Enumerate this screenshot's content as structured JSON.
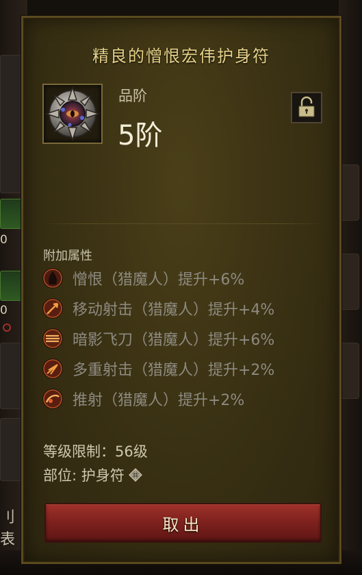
{
  "tooltip": {
    "title": "精良的憎恨宏伟护身符",
    "quality_label": "品阶",
    "quality_value": "5阶",
    "attributes_header": "附加属性",
    "affixes": [
      {
        "icon": "hatred-skill-icon",
        "text": "憎恨（猎魔人）提升+6%"
      },
      {
        "icon": "evasive-fire-skill-icon",
        "text": "移动射击（猎魔人）提升+4%"
      },
      {
        "icon": "shadow-blades-skill-icon",
        "text": "暗影飞刀（猎魔人）提升+6%"
      },
      {
        "icon": "multishot-skill-icon",
        "text": "多重射击（猎魔人）提升+2%"
      },
      {
        "icon": "strafe-skill-icon",
        "text": "推射（猎魔人）提升+2%"
      }
    ],
    "level_requirement": "等级限制：56级",
    "slot": "部位: 护身符",
    "take_out_button": "取出"
  },
  "background": {
    "left_numbers": [
      "0",
      "0"
    ],
    "left_char": "刂表"
  },
  "colors": {
    "title": "#e6d28a",
    "affix_text": "#8d8a80",
    "button": "#8a2520"
  }
}
